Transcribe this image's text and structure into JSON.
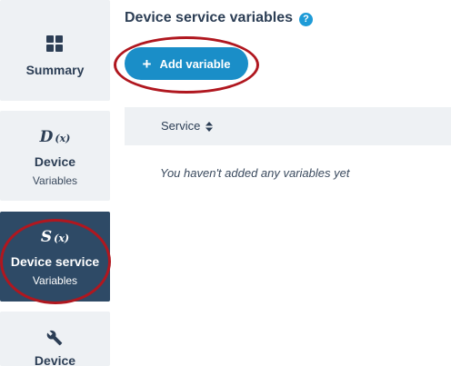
{
  "sidebar": {
    "items": [
      {
        "id": "summary",
        "label": "Summary",
        "icon": "grid-icon"
      },
      {
        "id": "device-variables",
        "symbol": "D",
        "symbol_sub": "(x)",
        "label": "Device",
        "sublabel": "Variables"
      },
      {
        "id": "device-service-variables",
        "symbol": "S",
        "symbol_sub": "(x)",
        "label": "Device service",
        "sublabel": "Variables",
        "active": true
      },
      {
        "id": "device",
        "label": "Device",
        "icon": "wrench-icon"
      }
    ]
  },
  "header": {
    "title": "Device service variables",
    "help_icon": "question-icon",
    "help_glyph": "?"
  },
  "actions": {
    "add_plus": "+",
    "add_label": "Add variable"
  },
  "table": {
    "columns": [
      {
        "label": "Service",
        "sortable": true
      }
    ],
    "empty_message": "You haven't added any variables yet"
  },
  "colors": {
    "accent": "#1a8ec8",
    "active_tile": "#2e4a66",
    "tile_bg": "#eef1f4",
    "annotation": "#b0171f"
  }
}
